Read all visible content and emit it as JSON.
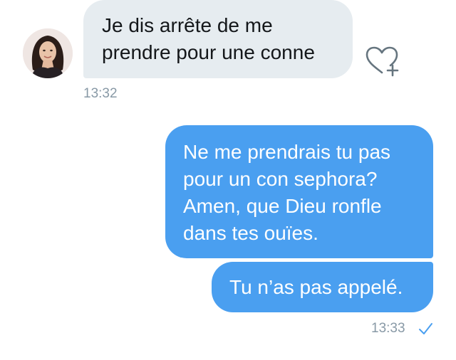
{
  "conversation": {
    "incoming": [
      {
        "lines": [
          "Je dis arrête de me",
          "prendre pour une conne"
        ],
        "time": "13:32",
        "avatar_icon": "contact-avatar",
        "like_icon": "heart-plus-icon"
      }
    ],
    "outgoing": [
      {
        "lines": [
          "Ne me prendrais tu pas",
          "pour un con sephora?",
          "Amen, que Dieu ronfle",
          "dans tes ouïes."
        ]
      },
      {
        "lines": [
          "Tu n’as pas appelé."
        ],
        "time": "13:33",
        "status_icon": "read-check-icon"
      }
    ]
  },
  "colors": {
    "incoming_bubble": "#e6ecf0",
    "outgoing_bubble": "#4a9ff0",
    "timestamp": "#8899a6",
    "incoming_text": "#14171a",
    "outgoing_text": "#ffffff"
  }
}
